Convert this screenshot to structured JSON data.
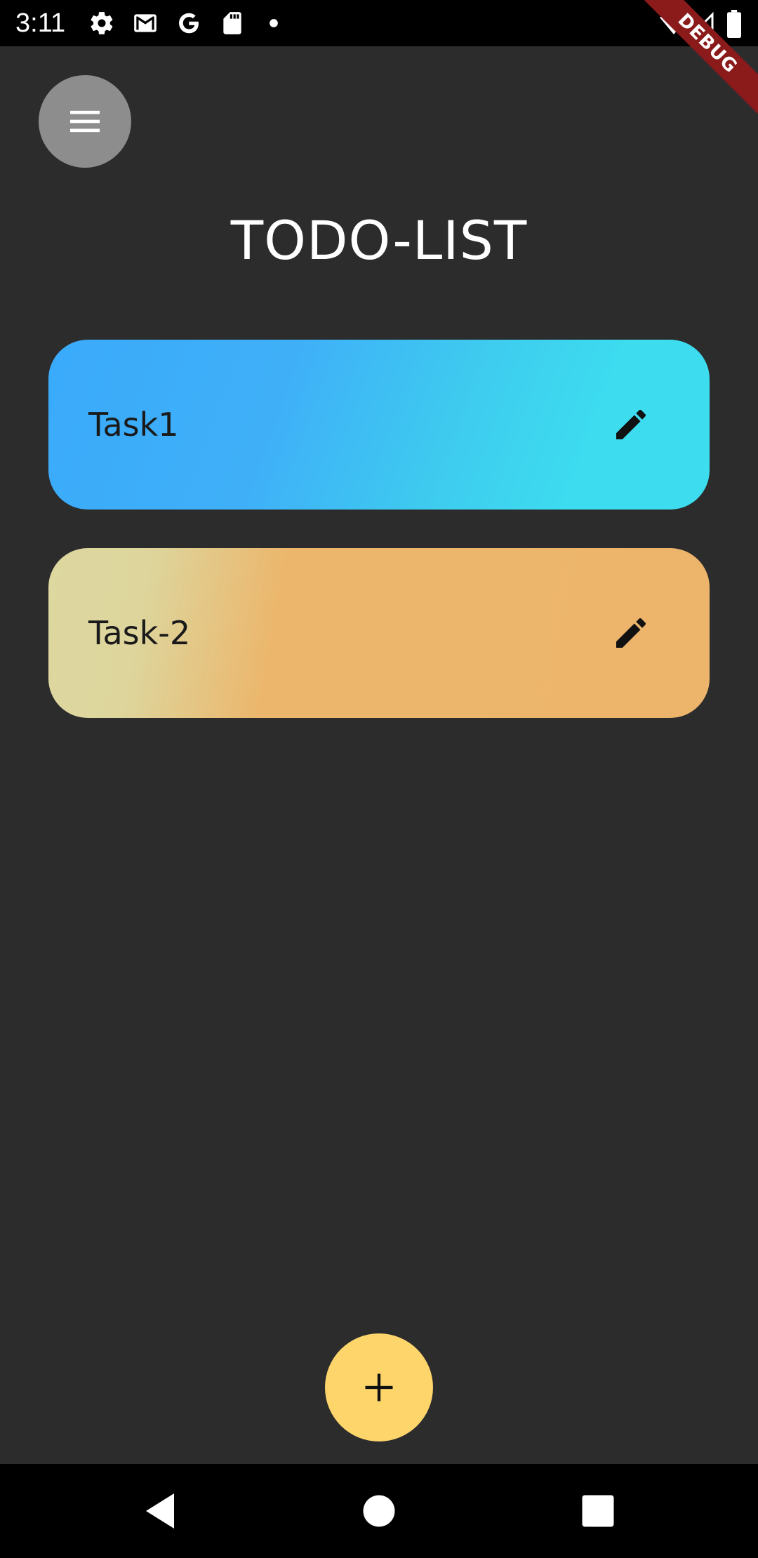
{
  "status_bar": {
    "time": "3:11",
    "icons": [
      "settings-icon",
      "gmail-icon",
      "google-icon",
      "sd-card-icon",
      "dot-icon",
      "wifi-icon",
      "signal-icon",
      "battery-icon"
    ]
  },
  "debug_banner": {
    "label": "DEBUG",
    "color": "#8b1a1a"
  },
  "header": {
    "menu_icon": "menu-icon",
    "title": "TODO-LIST"
  },
  "tasks": [
    {
      "label": "Task1",
      "icon": "edit-icon",
      "colors": [
        "#3aaafa",
        "#3ddcef"
      ]
    },
    {
      "label": "Task-2",
      "icon": "edit-icon",
      "colors": [
        "#ddd7a0",
        "#ecb56b"
      ]
    }
  ],
  "fab": {
    "icon": "plus-icon",
    "color": "#fdd56b"
  },
  "nav_bar": {
    "buttons": [
      "back-icon",
      "home-icon",
      "recents-icon"
    ]
  },
  "colors": {
    "background": "#2c2c2c",
    "menu_button": "#8d8d8d"
  }
}
